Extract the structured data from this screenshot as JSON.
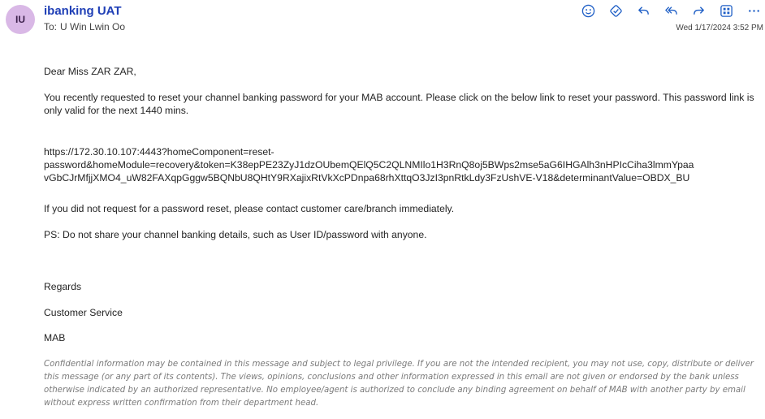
{
  "header": {
    "avatar_initials": "IU",
    "sender": "ibanking UAT",
    "to_label": "To:",
    "recipient": "U Win Lwin Oo",
    "timestamp": "Wed 1/17/2024 3:52 PM",
    "accent_color": "#1f3fb6",
    "avatar_color": "#d9b8e6",
    "actions": [
      "smiley-icon",
      "sensitivity-icon",
      "reply-icon",
      "reply-all-icon",
      "forward-icon",
      "apps-icon",
      "more-icon"
    ]
  },
  "message": {
    "greeting": "Dear Miss ZAR ZAR,",
    "intro": "You recently requested to reset your channel banking password for your MAB account. Please click on the below link to reset your password. This password link is only valid for the next 1440 mins.",
    "link": "https://172.30.10.107:4443?homeComponent=reset-password&homeModule=recovery&token=K38epPE23ZyJ1dzOUbemQElQ5C2QLNMIlo1H3RnQ8oj5BWps2mse5aG6IHGAlh3nHPIcCiha3lmmYpaavGbCJrMfjjXMO4_uW82FAXqpGggw5BQNbU8QHtY9RXajixRtVkXcPDnpa68rhXttqO3JzI3pnRtkLdy3FzUshVE-V18&determinantValue=OBDX_BU",
    "link_line1": "https://172.30.10.107:4443?homeComponent=reset-",
    "link_line2": "password&homeModule=recovery&token=K38epPE23ZyJ1dzOUbemQElQ5C2QLNMIlo1H3RnQ8oj5BWps2mse5aG6IHGAlh3nHPIcCiha3lmmYpaa",
    "link_line3": "vGbCJrMfjjXMO4_uW82FAXqpGggw5BQNbU8QHtY9RXajixRtVkXcPDnpa68rhXttqO3JzI3pnRtkLdy3FzUshVE-V18&determinantValue=OBDX_BU",
    "not_requested": "If you did not request for a password reset, please contact customer care/branch immediately.",
    "ps": "PS: Do not share your channel banking details, such as User ID/password with anyone.",
    "regards": "Regards",
    "signature_dept": "Customer Service",
    "signature_org": "MAB",
    "disclaimer": "Confidential information may be contained in this message and subject to legal privilege. If you are not the intended recipient, you may not use, copy, distribute or deliver this message (or any part of its contents). The views, opinions, conclusions and other information expressed in this email are not given or endorsed by the bank unless otherwise indicated by an authorized representative. No employee/agent is authorized to conclude any binding agreement on behalf of MAB with another party by email without express written confirmation from their department head."
  }
}
